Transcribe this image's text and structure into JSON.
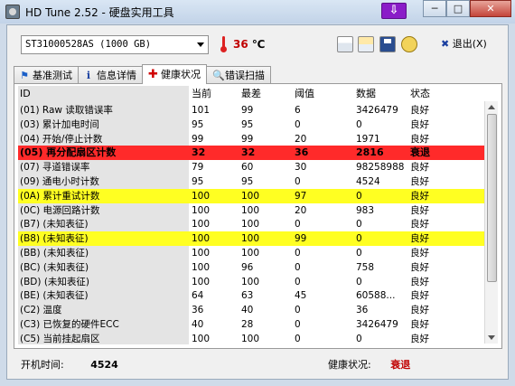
{
  "window": {
    "title": "HD Tune 2.52 - 硬盘实用工具",
    "download_glyph": "⇩",
    "minimize": "─",
    "maximize": "□",
    "close": "✕"
  },
  "toolbar": {
    "drive": "ST31000528AS (1000 GB)",
    "temperature_value": "36",
    "temperature_unit": "℃",
    "exit_label": "退出(X)",
    "exit_glyph": "✖"
  },
  "tabs": [
    {
      "label": "基准测试",
      "icon": "flag-icon"
    },
    {
      "label": "信息详情",
      "icon": "info-icon"
    },
    {
      "label": "健康状况",
      "icon": "health-cross-icon",
      "active": true
    },
    {
      "label": "错误扫描",
      "icon": "magnifier-icon"
    }
  ],
  "columns": [
    "ID",
    "当前",
    "最差",
    "阈值",
    "数据",
    "状态"
  ],
  "rows": [
    {
      "id": "(01) Raw 读取错误率",
      "current": "101",
      "worst": "99",
      "threshold": "6",
      "data": "3426479",
      "status": "良好",
      "highlight": ""
    },
    {
      "id": "(03) 累计加电时间",
      "current": "95",
      "worst": "95",
      "threshold": "0",
      "data": "0",
      "status": "良好",
      "highlight": ""
    },
    {
      "id": "(04) 开始/停止计数",
      "current": "99",
      "worst": "99",
      "threshold": "20",
      "data": "1971",
      "status": "良好",
      "highlight": ""
    },
    {
      "id": "(05) 再分配扇区计数",
      "current": "32",
      "worst": "32",
      "threshold": "36",
      "data": "2816",
      "status": "衰退",
      "highlight": "red"
    },
    {
      "id": "(07) 寻道错误率",
      "current": "79",
      "worst": "60",
      "threshold": "30",
      "data": "98258988",
      "status": "良好",
      "highlight": ""
    },
    {
      "id": "(09) 通电小时计数",
      "current": "95",
      "worst": "95",
      "threshold": "0",
      "data": "4524",
      "status": "良好",
      "highlight": ""
    },
    {
      "id": "(0A) 累计重试计数",
      "current": "100",
      "worst": "100",
      "threshold": "97",
      "data": "0",
      "status": "良好",
      "highlight": "yellow"
    },
    {
      "id": "(0C) 电源回路计数",
      "current": "100",
      "worst": "100",
      "threshold": "20",
      "data": "983",
      "status": "良好",
      "highlight": ""
    },
    {
      "id": "(B7) (未知表征)",
      "current": "100",
      "worst": "100",
      "threshold": "0",
      "data": "0",
      "status": "良好",
      "highlight": ""
    },
    {
      "id": "(B8) (未知表征)",
      "current": "100",
      "worst": "100",
      "threshold": "99",
      "data": "0",
      "status": "良好",
      "highlight": "yellow"
    },
    {
      "id": "(BB) (未知表征)",
      "current": "100",
      "worst": "100",
      "threshold": "0",
      "data": "0",
      "status": "良好",
      "highlight": ""
    },
    {
      "id": "(BC) (未知表征)",
      "current": "100",
      "worst": "96",
      "threshold": "0",
      "data": "758",
      "status": "良好",
      "highlight": ""
    },
    {
      "id": "(BD) (未知表征)",
      "current": "100",
      "worst": "100",
      "threshold": "0",
      "data": "0",
      "status": "良好",
      "highlight": ""
    },
    {
      "id": "(BE) (未知表征)",
      "current": "64",
      "worst": "63",
      "threshold": "45",
      "data": "60588...",
      "status": "良好",
      "highlight": ""
    },
    {
      "id": "(C2) 温度",
      "current": "36",
      "worst": "40",
      "threshold": "0",
      "data": "36",
      "status": "良好",
      "highlight": ""
    },
    {
      "id": "(C3) 已恢复的硬件ECC",
      "current": "40",
      "worst": "28",
      "threshold": "0",
      "data": "3426479",
      "status": "良好",
      "highlight": ""
    },
    {
      "id": "(C5) 当前挂起扇区",
      "current": "100",
      "worst": "100",
      "threshold": "0",
      "data": "0",
      "status": "良好",
      "highlight": ""
    }
  ],
  "status": {
    "power_on_label": "开机时间:",
    "power_on_value": "4524",
    "health_label": "健康状况:",
    "health_value": "衰退"
  },
  "colors": {
    "warning_row": "#ff2a2a",
    "caution_row": "#ffff22",
    "degraded_text": "#c00000"
  }
}
